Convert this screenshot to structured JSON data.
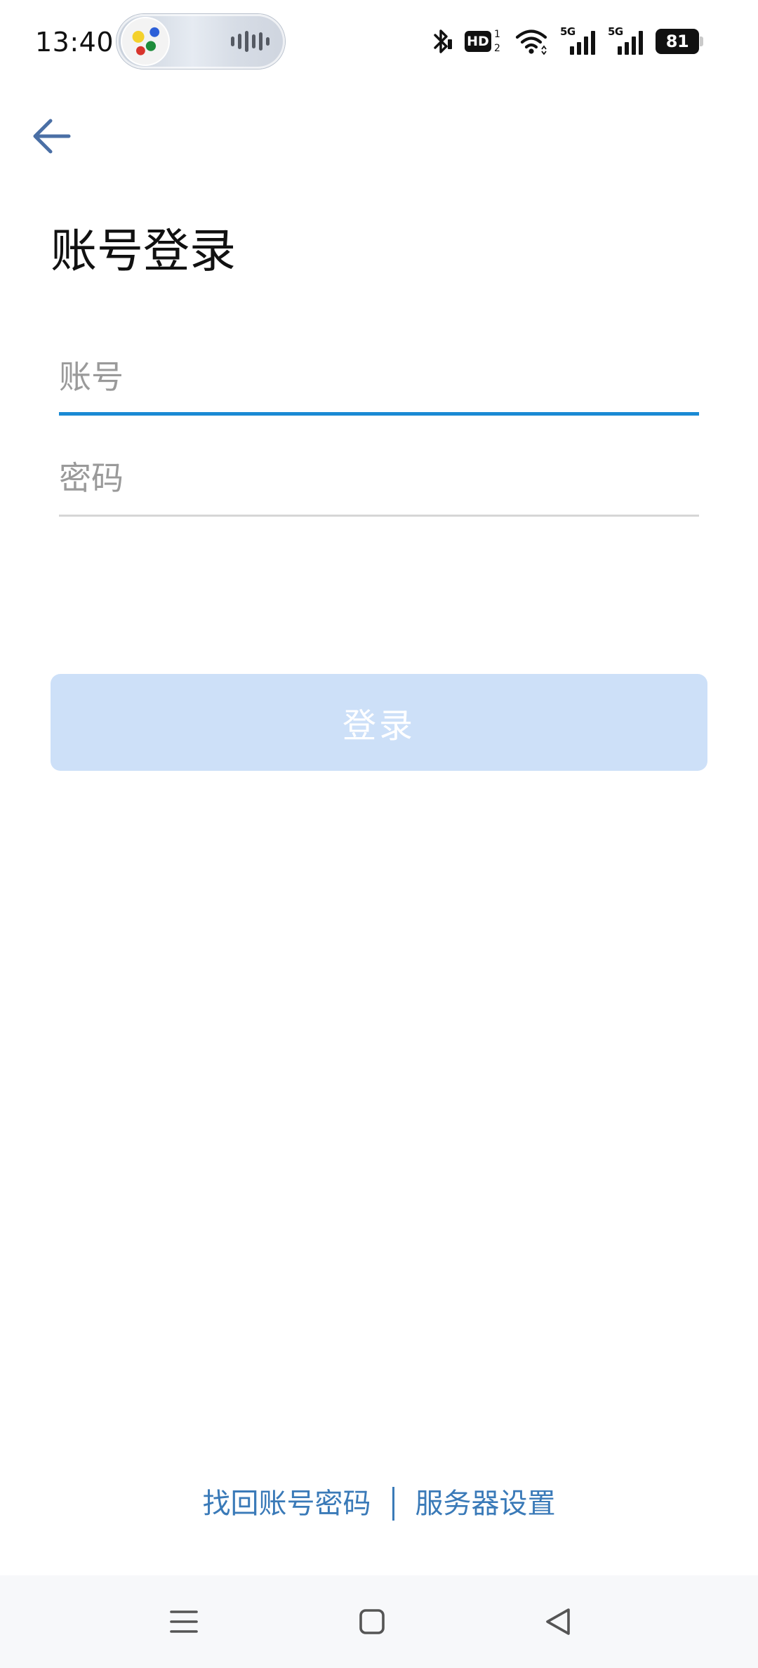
{
  "status_bar": {
    "time": "13:40",
    "hd_label": "HD",
    "hd_sup": "1",
    "hd_sub": "2",
    "network_label_1": "5G",
    "network_label_2": "5G",
    "battery_level": "81"
  },
  "header": {
    "title": "账号登录"
  },
  "form": {
    "account_placeholder": "账号",
    "password_placeholder": "密码",
    "login_label": "登录"
  },
  "footer_links": {
    "recover": "找回账号密码",
    "server_settings": "服务器设置"
  },
  "colors": {
    "accent_underline": "#1a8ad4",
    "login_button_disabled": "#cde0f8",
    "link": "#3a7ab8",
    "back_arrow": "#4a6fa5"
  },
  "icons": {
    "back": "arrow-left-icon",
    "nav_menu": "menu-icon",
    "nav_home": "home-square-icon",
    "nav_back": "triangle-back-icon"
  }
}
